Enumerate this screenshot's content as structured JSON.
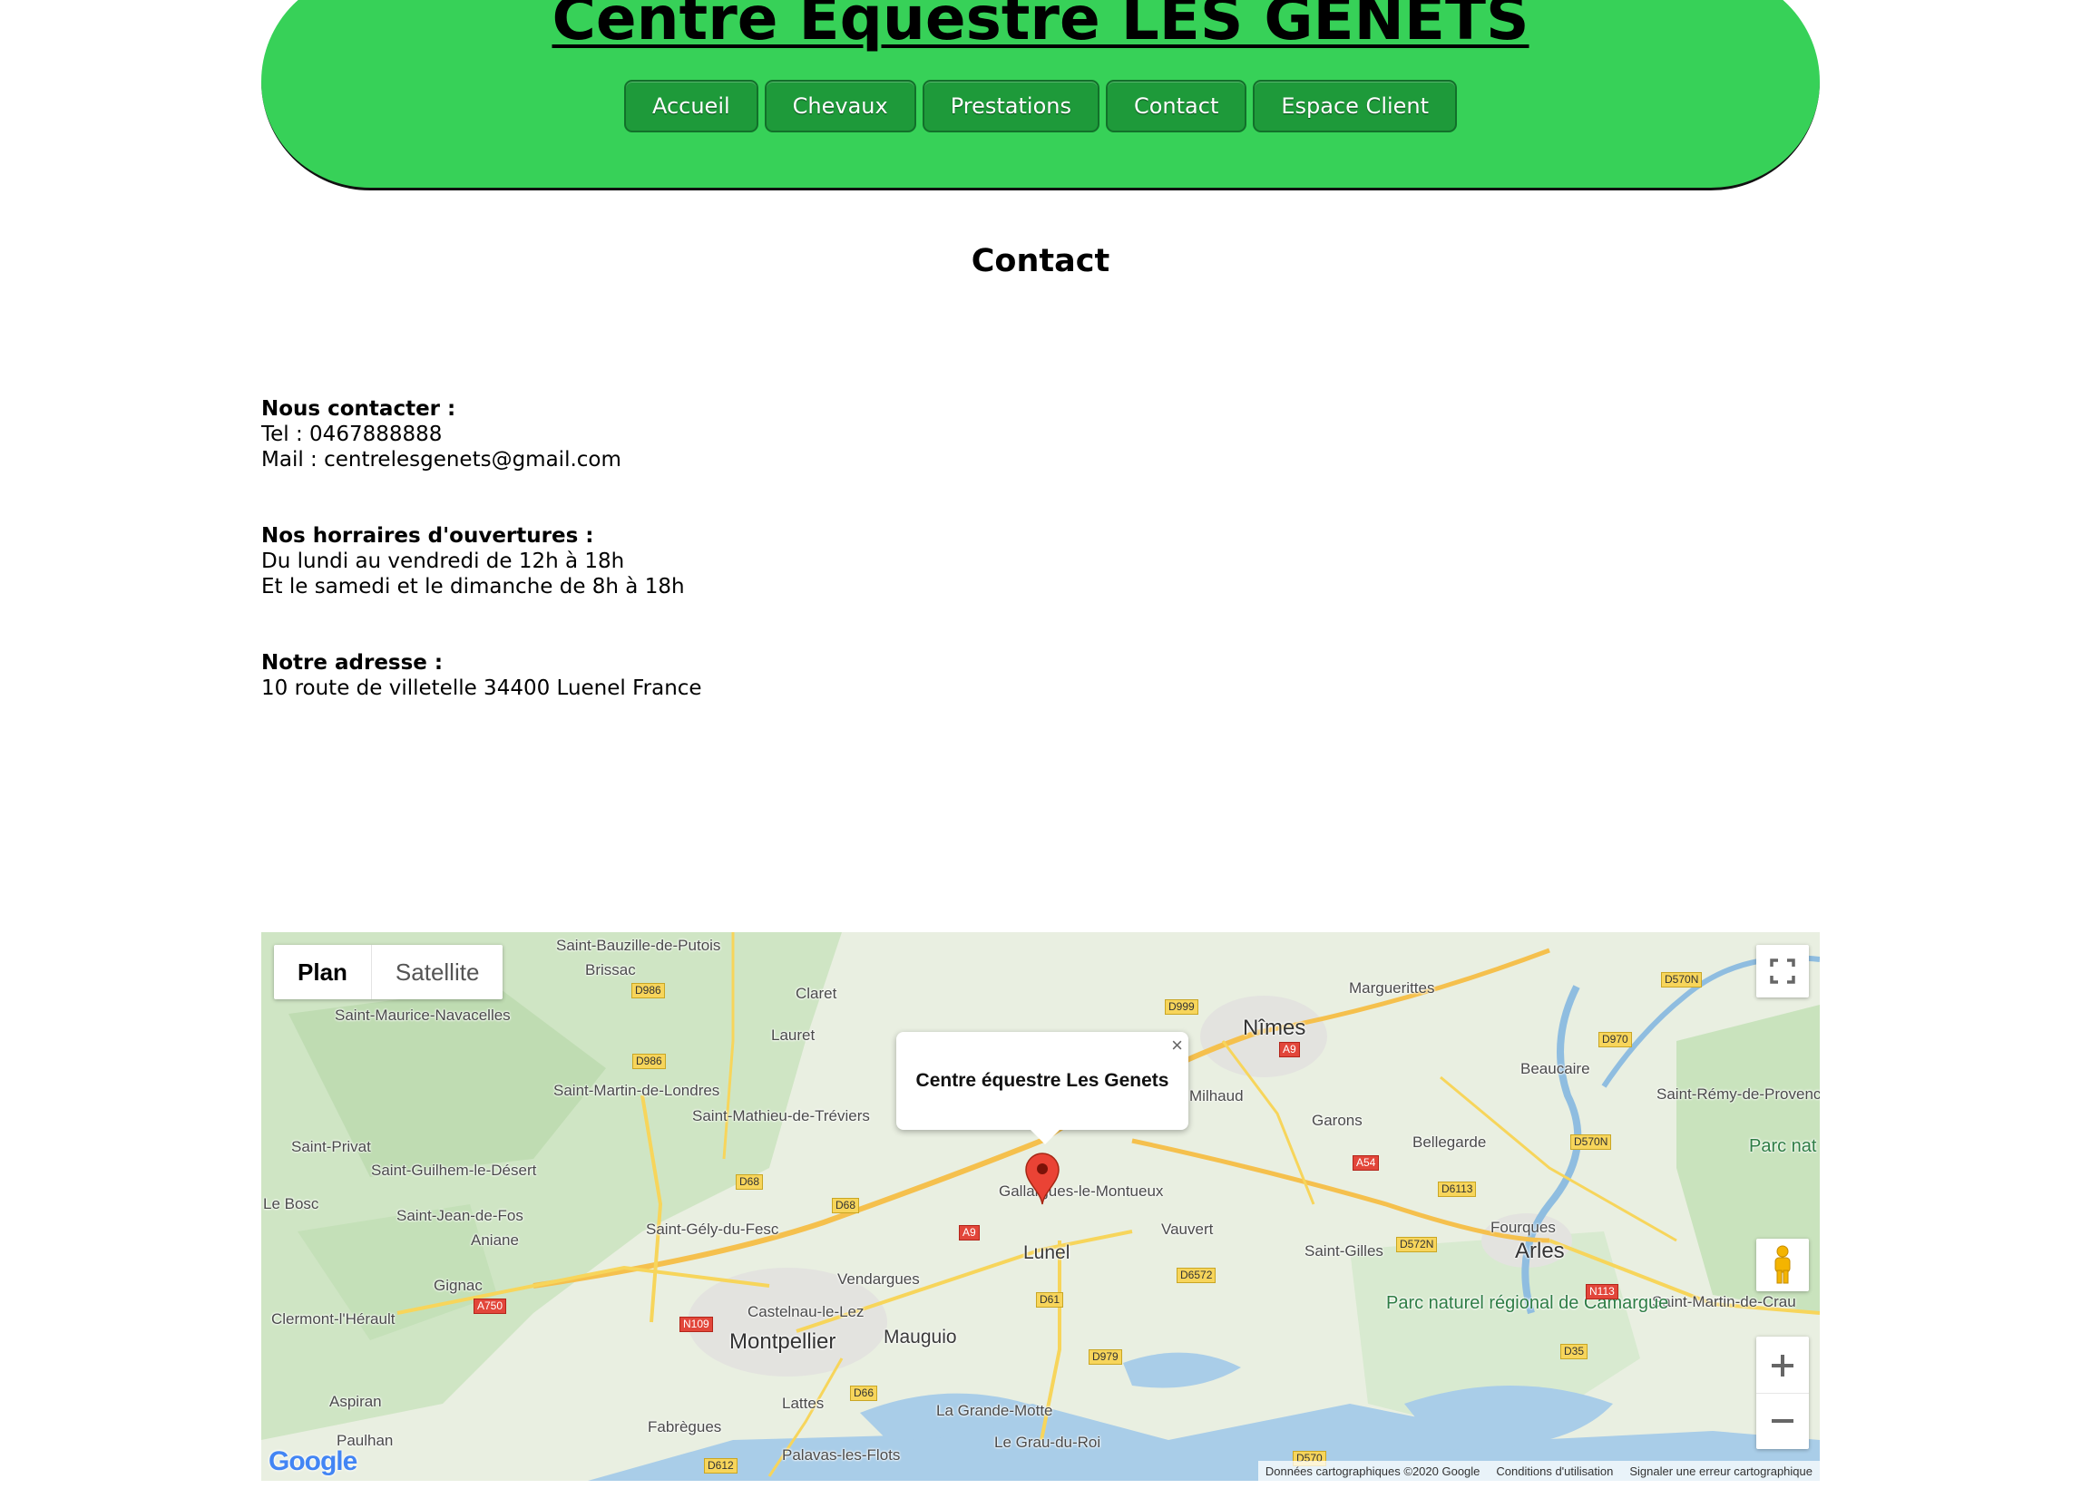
{
  "header": {
    "title": "Centre Equestre LES GENETS",
    "nav": [
      "Accueil",
      "Chevaux",
      "Prestations",
      "Contact",
      "Espace Client"
    ]
  },
  "page_title": "Contact",
  "contact": {
    "label": "Nous contacter :",
    "tel": "Tel : 0467888888",
    "mail": "Mail : centrelesgenets@gmail.com"
  },
  "hours": {
    "label": "Nos horraires d'ouvertures :",
    "weekdays": "Du lundi au vendredi de 12h à 18h",
    "weekend": "Et le samedi et le dimanche de 8h à 18h"
  },
  "address": {
    "label": "Notre adresse :",
    "value": "10 route de villetelle 34400 Luenel France"
  },
  "map": {
    "type_buttons": [
      "Plan",
      "Satellite"
    ],
    "active_type": "Plan",
    "infowindow_title": "Centre équestre Les Genets",
    "close_icon": "×",
    "logo": "Google",
    "attribution": [
      "Données cartographiques ©2020 Google",
      "Conditions d'utilisation",
      "Signaler une erreur cartographique"
    ],
    "places": [
      "Saint-Bauzille-de-Putois",
      "Brissac",
      "Saint-Maurice-Navacelles",
      "Claret",
      "Lauret",
      "Saint-Martin-de-Londres",
      "Saint-Mathieu-de-Tréviers",
      "Saint-Privat",
      "Saint-Guilhem-le-Désert",
      "Le Bosc",
      "Saint-Jean-de-Fos",
      "Aniane",
      "Gignac",
      "Clermont-l'Hérault",
      "Saint-Gély-du-Fesc",
      "Vendargues",
      "Castelnau-le-Lez",
      "Montpellier",
      "Mauguio",
      "Lattes",
      "Fabrègues",
      "Aspiran",
      "Paulhan",
      "Palavas-les-Flots",
      "La Grande-Motte",
      "Le Grau-du-Roi",
      "Gallargues-le-Montueux",
      "Lunel",
      "Vauvert",
      "Milhaud",
      "Nîmes",
      "Marguerittes",
      "Garons",
      "Bellegarde",
      "Saint-Gilles",
      "Beaucaire",
      "Fourques",
      "Arles",
      "Saint-Rémy-de-Provence",
      "Saint-Martin-de-Crau"
    ],
    "parks": [
      "Parc naturel régional de Camargue",
      "Parc nat région des Alpi"
    ],
    "roads": [
      "D986",
      "D986",
      "D999",
      "A9",
      "D68",
      "D68",
      "A9",
      "A750",
      "N109",
      "D61",
      "D66",
      "D612",
      "D979",
      "D6572",
      "A54",
      "D6113",
      "D572N",
      "D570N",
      "D570N",
      "D970",
      "N113",
      "D35",
      "D570"
    ]
  }
}
